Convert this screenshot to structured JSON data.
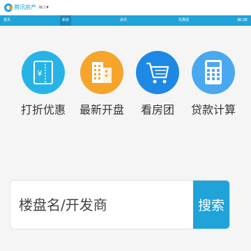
{
  "header": {
    "brand": "腾讯房产",
    "city": "海口",
    "city_arrow": "▼"
  },
  "nav": {
    "items": [
      {
        "label": "首页",
        "active": false
      },
      {
        "label": "新房",
        "active": true
      },
      {
        "label": "资讯",
        "active": false
      },
      {
        "label": "优惠团",
        "active": false
      },
      {
        "label": "海口房",
        "active": false
      }
    ]
  },
  "features": [
    {
      "label": "打折优惠",
      "icon": "coupon-icon",
      "color": "#26b4e8"
    },
    {
      "label": "最新开盘",
      "icon": "building-icon",
      "color": "#f5a52a"
    },
    {
      "label": "看房团",
      "icon": "cart-icon",
      "color": "#1e88e5"
    },
    {
      "label": "贷款计算",
      "icon": "calculator-icon",
      "color": "#4aa8f0"
    }
  ],
  "search": {
    "placeholder": "楼盘名/开发商",
    "button_label": "搜索"
  },
  "colors": {
    "accent": "#1fa3d9",
    "background": "#f5f5f5"
  }
}
